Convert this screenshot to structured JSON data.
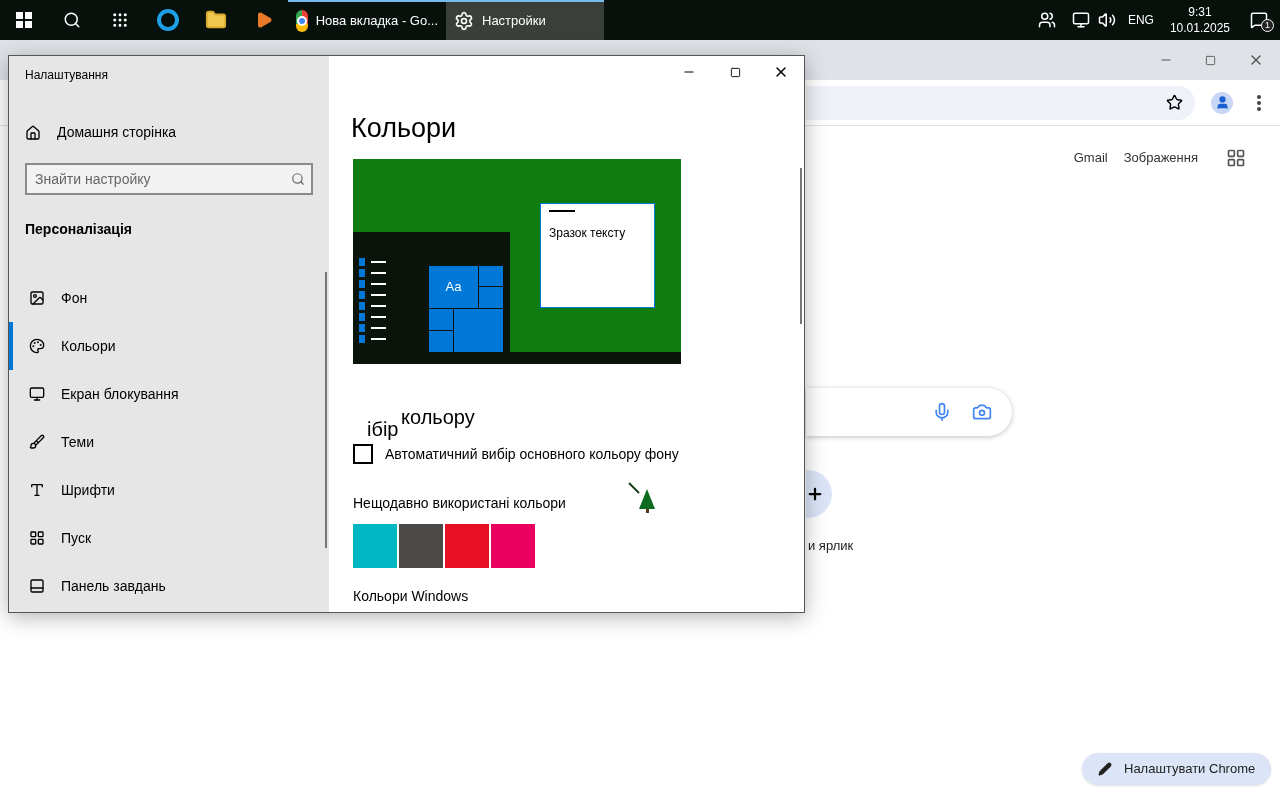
{
  "taskbar": {
    "apps": [
      {
        "kind": "chrome",
        "label": "Нова вкладка - Go...",
        "selected": false
      },
      {
        "kind": "settings",
        "label": "Настройки",
        "selected": true
      }
    ],
    "tray": {
      "language": "ENG",
      "time": "9:31",
      "date": "10.01.2025",
      "notifications": "1"
    }
  },
  "browser": {
    "links": [
      "Gmail",
      "Зображення"
    ],
    "shortcut_label": "и ярлик",
    "customize_button": "Налаштувати Chrome"
  },
  "settings": {
    "window_title": "Налаштування",
    "home": "Домашня сторінка",
    "search": {
      "placeholder": "Знайти настройку"
    },
    "section": "Персоналізація",
    "nav": [
      {
        "label": "Фон",
        "selected": false
      },
      {
        "label": "Кольори",
        "selected": true
      },
      {
        "label": "Екран блокування",
        "selected": false
      },
      {
        "label": "Теми",
        "selected": false
      },
      {
        "label": "Шрифти",
        "selected": false
      },
      {
        "label": "Пуск",
        "selected": false
      },
      {
        "label": "Панель завдань",
        "selected": false
      }
    ],
    "page_title": "Кольори",
    "preview_text": "Зразок тексту",
    "preview_tile": "Aa",
    "choose_heading": "кольору",
    "choose_fragment": "ібір",
    "auto_color": {
      "label": "Автоматичний вибір основного кольору фону",
      "checked": false
    },
    "recent_heading": "Нещодавно використані кольори",
    "recent_colors": [
      {
        "color": "#00b7c3"
      },
      {
        "color": "#4c4a48"
      },
      {
        "color": "#e81123"
      },
      {
        "color": "#ea005e"
      }
    ],
    "windows_colors_heading": "Кольори Windows"
  }
}
